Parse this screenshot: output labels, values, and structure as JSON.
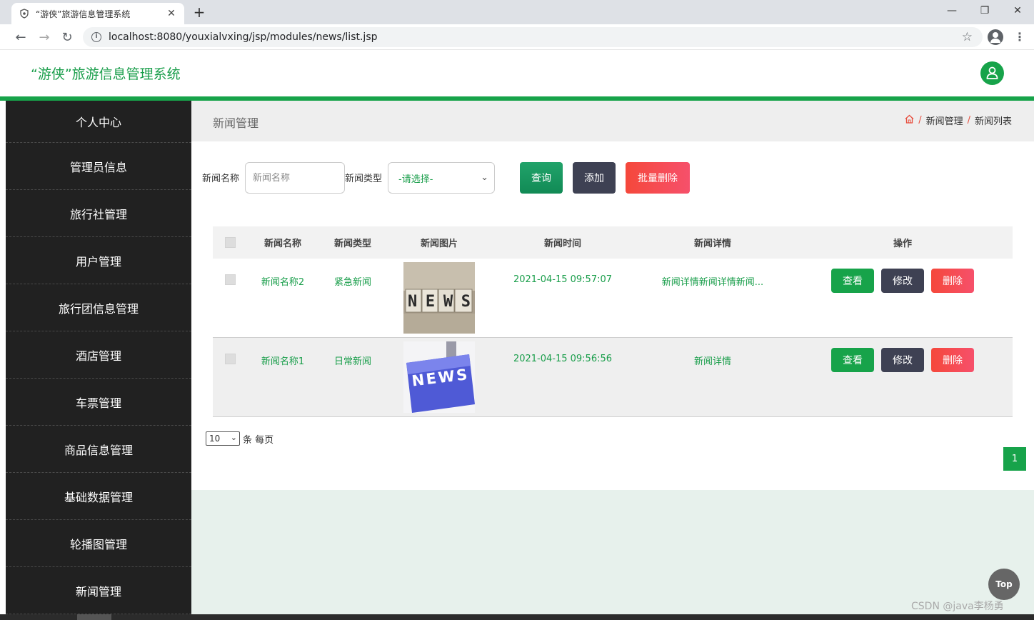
{
  "browser": {
    "tab_title": "“游侠”旅游信息管理系统",
    "url": "localhost:8080/youxialvxing/jsp/modules/news/list.jsp"
  },
  "app": {
    "title": "“游侠”旅游信息管理系统"
  },
  "sidebar": {
    "items": [
      {
        "label": "个人中心"
      },
      {
        "label": "管理员信息"
      },
      {
        "label": "旅行社管理"
      },
      {
        "label": "用户管理"
      },
      {
        "label": "旅行团信息管理"
      },
      {
        "label": "酒店管理"
      },
      {
        "label": "车票管理"
      },
      {
        "label": "商品信息管理"
      },
      {
        "label": "基础数据管理"
      },
      {
        "label": "轮播图管理"
      },
      {
        "label": "新闻管理"
      }
    ]
  },
  "page": {
    "title": "新闻管理",
    "breadcrumb": [
      "新闻管理",
      "新闻列表"
    ]
  },
  "search": {
    "name_label": "新闻名称",
    "name_placeholder": "新闻名称",
    "type_label": "新闻类型",
    "type_selected": "-请选择-",
    "query_button": "查询",
    "add_button": "添加",
    "batch_delete_button": "批量删除"
  },
  "table": {
    "headers": [
      "新闻名称",
      "新闻类型",
      "新闻图片",
      "新闻时间",
      "新闻详情",
      "操作"
    ],
    "rows": [
      {
        "name": "新闻名称2",
        "type": "紧急新闻",
        "time": "2021-04-15 09:57:07",
        "detail": "新闻详情新闻详情新闻...",
        "image_word": "NEWS"
      },
      {
        "name": "新闻名称1",
        "type": "日常新闻",
        "time": "2021-04-15 09:56:56",
        "detail": "新闻详情",
        "image_word": "NEWS"
      }
    ],
    "op_view": "查看",
    "op_edit": "修改",
    "op_delete": "删除"
  },
  "pagination": {
    "page_size": "10",
    "page_size_suffix": "条 每页",
    "current_page": "1"
  },
  "top_button": "Top",
  "watermark": "CSDN @java李杨勇",
  "colors": {
    "brand_green": "#17a34a",
    "sidebar_bg": "#212121",
    "danger": "#f5483b",
    "dark_button": "#3e4153"
  }
}
